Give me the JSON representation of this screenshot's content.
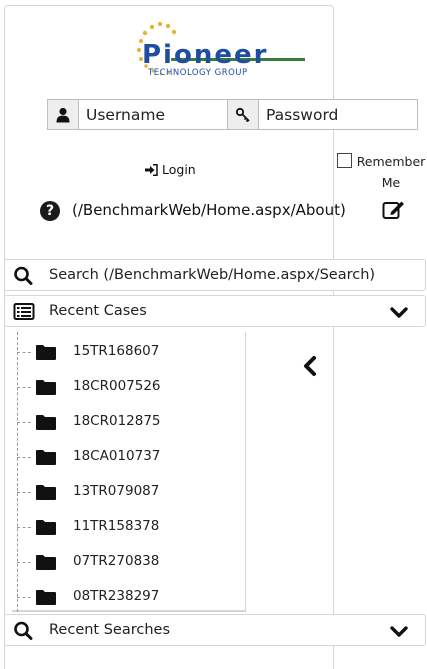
{
  "logo": {
    "name": "Pioneer",
    "tagline": "TECHNOLOGY GROUP",
    "brand_color": "#1f4ea1",
    "dot_color": "#e7b332"
  },
  "login": {
    "username_placeholder": "Username",
    "password_placeholder": "Password",
    "username_icon": "user-icon",
    "password_icon": "key-icon",
    "login_label": "Login",
    "remember_label": "Remember Me"
  },
  "about": {
    "link_text": "(/BenchmarkWeb/Home.aspx/About)",
    "icon": "question-circle-icon",
    "edit_icon": "edit-icon"
  },
  "search": {
    "label": "Search (/BenchmarkWeb/Home.aspx/Search)",
    "icon": "search-icon"
  },
  "recent_cases": {
    "label": "Recent Cases",
    "icon": "list-icon",
    "items": [
      "15TR168607",
      "18CR007526",
      "18CR012875",
      "18CA010737",
      "13TR079087",
      "11TR158378",
      "07TR270838",
      "08TR238297"
    ]
  },
  "recent_searches": {
    "label": "Recent Searches",
    "icon": "search-icon"
  }
}
